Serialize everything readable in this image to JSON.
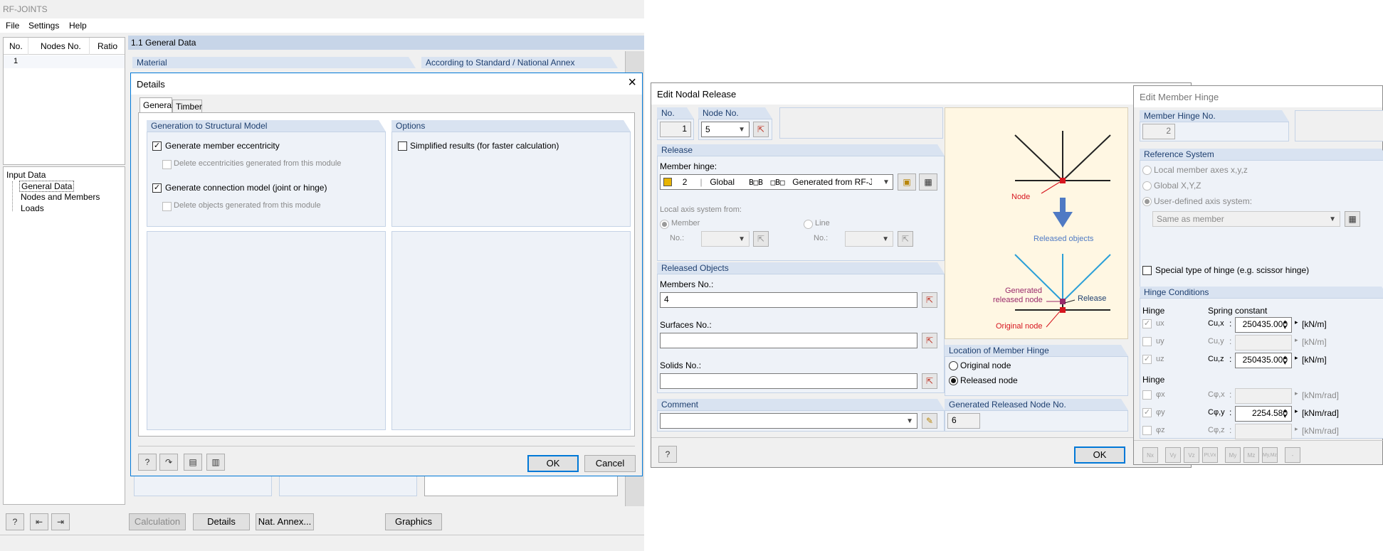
{
  "main": {
    "title": "RF-JOINTS",
    "menu": [
      "File",
      "Settings",
      "Help"
    ],
    "table_headers": [
      "No.",
      "Nodes No.",
      "Ratio"
    ],
    "table_rows": [
      [
        "1",
        "",
        ""
      ]
    ],
    "tree_root": "Input Data",
    "tree_items": [
      "General Data",
      "Nodes and Members",
      "Loads"
    ],
    "section_title": "1.1 General Data",
    "material_label": "Material",
    "standard_label": "According to Standard / National Annex",
    "bottom_buttons": {
      "calculation": "Calculation",
      "details": "Details",
      "nat_annex": "Nat. Annex...",
      "graphics": "Graphics"
    }
  },
  "details": {
    "title": "Details",
    "tabs": [
      "General",
      "Timber"
    ],
    "gen_model_title": "Generation to Structural Model",
    "gen_eccentricity": "Generate member eccentricity",
    "delete_eccentricities": "Delete eccentricities generated from this module",
    "gen_connection": "Generate connection model (joint or hinge)",
    "delete_objects": "Delete objects generated from this module",
    "options_title": "Options",
    "simplified_results": "Simplified results (for faster calculation)",
    "ok": "OK",
    "cancel": "Cancel"
  },
  "nodal": {
    "title": "Edit Nodal Release",
    "no_label": "No.",
    "no_value": "1",
    "node_no_label": "Node No.",
    "node_no_value": "5",
    "release_title": "Release",
    "member_hinge_label": "Member hinge:",
    "hinge_no": "2",
    "hinge_axis": "Global",
    "hinge_generated": "Generated from RF-JOI",
    "hinge_flags_1": "B□B",
    "hinge_flags_2": "□B□",
    "local_axis_label": "Local axis system from:",
    "member_radio": "Member",
    "line_radio": "Line",
    "no_small_label": "No.:",
    "released_objects_title": "Released Objects",
    "members_no_label": "Members No.:",
    "members_no_value": "4",
    "surfaces_no_label": "Surfaces No.:",
    "solids_no_label": "Solids No.:",
    "comment_title": "Comment",
    "diagram": {
      "node": "Node",
      "released_objects": "Released objects",
      "generated_1": "Generated",
      "generated_2": "released node",
      "release": "Release",
      "original_node": "Original node"
    },
    "location_title": "Location of Member Hinge",
    "original_node": "Original node",
    "released_node": "Released node",
    "generated_released_title": "Generated Released Node No.",
    "generated_released_value": "6",
    "ok": "OK"
  },
  "hinge": {
    "title": "Edit Member Hinge",
    "hinge_no_label": "Member Hinge No.",
    "hinge_no_value": "2",
    "ref_system_title": "Reference System",
    "local_axes": "Local member axes x,y,z",
    "global_axes": "Global X,Y,Z",
    "user_defined": "User-defined axis system:",
    "same_as_member": "Same as member",
    "special_type": "Special type of hinge (e.g. scissor hinge)",
    "conditions_title": "Hinge Conditions",
    "hinge_label": "Hinge",
    "spring_label": "Spring constant",
    "rows_translation": [
      {
        "dof": "ux",
        "spring": "Cu,x",
        "value": "250435.000",
        "unit": "[kN/m]",
        "checked": true
      },
      {
        "dof": "uy",
        "spring": "Cu,y",
        "value": "",
        "unit": "[kN/m]",
        "checked": false
      },
      {
        "dof": "uz",
        "spring": "Cu,z",
        "value": "250435.000",
        "unit": "[kN/m]",
        "checked": true
      }
    ],
    "rows_rotation": [
      {
        "dof": "φx",
        "spring": "Cφ,x",
        "value": "",
        "unit": "[kNm/rad]",
        "checked": false
      },
      {
        "dof": "φy",
        "spring": "Cφ,y",
        "value": "2254.580",
        "unit": "[kNm/rad]",
        "checked": true
      },
      {
        "dof": "φz",
        "spring": "Cφ,z",
        "value": "",
        "unit": "[kNm/rad]",
        "checked": false
      }
    ],
    "toolbar": [
      "Nx",
      "Vy",
      "Vz",
      "Pt,Vx",
      "My",
      "Mz",
      "My,Mz",
      "-"
    ]
  },
  "colors": {
    "accent": "#0078d7",
    "group_header": "#d9e3f1",
    "diagram_red": "#d6161f",
    "diagram_blue": "#2a9fd8",
    "diagram_purple": "#9a2a6a"
  }
}
